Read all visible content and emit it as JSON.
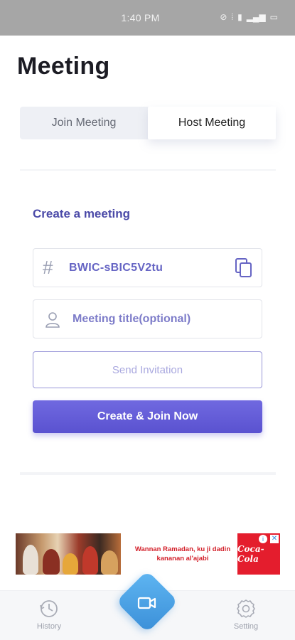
{
  "status_bar": {
    "time": "1:40 PM",
    "icons": [
      "do-not-disturb-icon",
      "vibrate-icon",
      "signal-icon",
      "signal-icon",
      "battery-icon"
    ]
  },
  "page": {
    "title": "Meeting"
  },
  "tabs": [
    {
      "label": "Join Meeting",
      "active": false
    },
    {
      "label": "Host Meeting",
      "active": true
    }
  ],
  "create": {
    "section_title": "Create a meeting",
    "meeting_code": "BWIC-sBIC5V2tu",
    "title_placeholder": "Meeting title(optional)",
    "send_invitation_label": "Send Invitation",
    "create_join_label": "Create & Join Now"
  },
  "ad": {
    "text": "Wannan Ramadan, ku ji dadin kananan al'ajabi",
    "brand": "Coca-Cola"
  },
  "bottom_nav": {
    "history_label": "History",
    "setting_label": "Setting"
  },
  "colors": {
    "accent": "#5a52d0",
    "accent_text": "#4b4aa8",
    "status_bar": "#a6a6a6",
    "nav_center": "#3b8fd8"
  }
}
